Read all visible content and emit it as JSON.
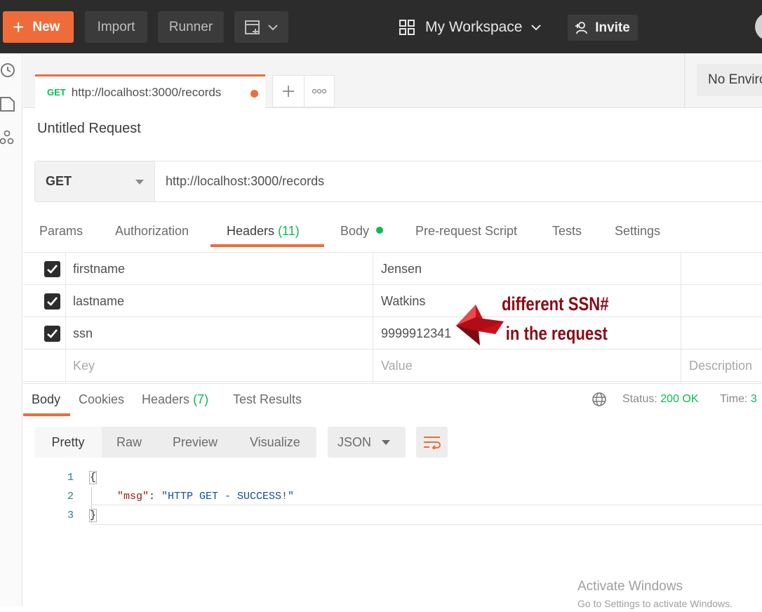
{
  "topbar": {
    "new_label": "New",
    "import_label": "Import",
    "runner_label": "Runner",
    "workspace_label": "My Workspace",
    "invite_label": "Invite"
  },
  "request_tab": {
    "method": "GET",
    "url": "http://localhost:3000/records"
  },
  "environment": {
    "label": "No Environment"
  },
  "request": {
    "title": "Untitled Request",
    "method": "GET",
    "url": "http://localhost:3000/records"
  },
  "request_tabs": {
    "params": "Params",
    "authorization": "Authorization",
    "headers": "Headers",
    "headers_count": "(11)",
    "body": "Body",
    "prerequest": "Pre-request Script",
    "tests": "Tests",
    "settings": "Settings"
  },
  "headers": {
    "rows": [
      {
        "key": "firstname",
        "value": "Jensen"
      },
      {
        "key": "lastname",
        "value": "Watkins"
      },
      {
        "key": "ssn",
        "value": "9999912341"
      }
    ],
    "key_placeholder": "Key",
    "value_placeholder": "Value",
    "description_placeholder": "Description"
  },
  "annotation": {
    "line1": "different SSN#",
    "line2": "in the request"
  },
  "response_tabs": {
    "body": "Body",
    "cookies": "Cookies",
    "headers": "Headers",
    "headers_count": "(7)",
    "test_results": "Test Results",
    "status_label": "Status:",
    "status_value": "200 OK",
    "time_label": "Time:",
    "time_value": "3"
  },
  "response_toolbar": {
    "pretty": "Pretty",
    "raw": "Raw",
    "preview": "Preview",
    "visualize": "Visualize",
    "format": "JSON"
  },
  "response_body": {
    "line_numbers": [
      "1",
      "2",
      "3"
    ],
    "open_brace": "{",
    "key": "\"msg\"",
    "value": "\"HTTP GET - SUCCESS!\"",
    "close_brace": "}"
  },
  "watermark": {
    "line1": "Activate Windows",
    "line2": "Go to Settings to activate Windows."
  },
  "colors": {
    "accent": "#ef6c3a",
    "success": "#0cbb52",
    "annotation": "#8b0a14",
    "topbar": "#2c2c2c"
  }
}
